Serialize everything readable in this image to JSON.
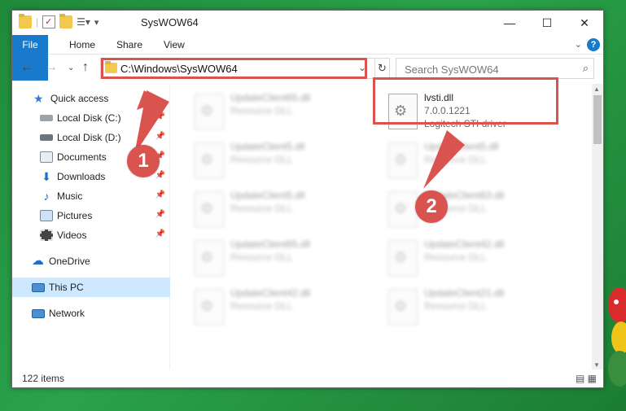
{
  "window": {
    "title": "SysWOW64"
  },
  "ribbon": {
    "tabs": [
      "File",
      "Home",
      "Share",
      "View"
    ],
    "help": "?"
  },
  "nav": {
    "address": "C:\\Windows\\SysWOW64",
    "search_placeholder": "Search SysWOW64"
  },
  "sidebar": {
    "items": [
      {
        "label": "Quick access",
        "icon": "star-icon",
        "pinned": false,
        "selected": false
      },
      {
        "label": "Local Disk (C:)",
        "icon": "drive-icon",
        "pinned": true,
        "selected": false
      },
      {
        "label": "Local Disk (D:)",
        "icon": "drive-icon",
        "pinned": true,
        "selected": false
      },
      {
        "label": "Documents",
        "icon": "documents-icon",
        "pinned": true,
        "selected": false
      },
      {
        "label": "Downloads",
        "icon": "download-icon",
        "pinned": true,
        "selected": false
      },
      {
        "label": "Music",
        "icon": "music-icon",
        "pinned": true,
        "selected": false
      },
      {
        "label": "Pictures",
        "icon": "pictures-icon",
        "pinned": true,
        "selected": false
      },
      {
        "label": "Videos",
        "icon": "videos-icon",
        "pinned": true,
        "selected": false
      },
      {
        "label": "OneDrive",
        "icon": "cloud-icon",
        "pinned": false,
        "selected": false
      },
      {
        "label": "This PC",
        "icon": "computer-icon",
        "pinned": false,
        "selected": true
      },
      {
        "label": "Network",
        "icon": "network-icon",
        "pinned": false,
        "selected": false
      }
    ]
  },
  "files": [
    {
      "name": "UpdateClient65.dll",
      "type": "Resource DLL",
      "blurred": true
    },
    {
      "name": "lvsti.dll",
      "type": "7.0.0.1221",
      "desc": "Logitech STI driver",
      "blurred": false
    },
    {
      "name": "UpdateClient5.dll",
      "type": "Resource DLL",
      "blurred": true
    },
    {
      "name": "UpdateClient5.dll",
      "type": "Resource DLL",
      "blurred": true
    },
    {
      "name": "UpdateClient5.dll",
      "type": "Resource DLL",
      "blurred": true
    },
    {
      "name": "UpdateClient63.dll",
      "type": "Resource DLL",
      "blurred": true
    },
    {
      "name": "UpdateClient65.dll",
      "type": "Resource DLL",
      "blurred": true
    },
    {
      "name": "UpdateClient42.dll",
      "type": "Resource DLL",
      "blurred": true
    },
    {
      "name": "UpdateClient42.dll",
      "type": "Resource DLL",
      "blurred": true
    },
    {
      "name": "UpdateClient21.dll",
      "type": "Resource DLL",
      "blurred": true
    }
  ],
  "status": {
    "count": "122 items"
  },
  "annotations": {
    "step1": "1",
    "step2": "2",
    "color": "#d9534f"
  }
}
